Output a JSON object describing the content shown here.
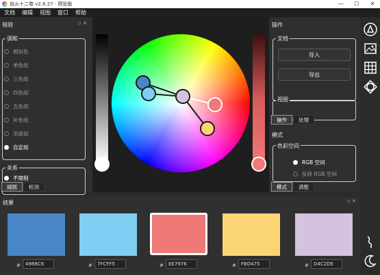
{
  "window": {
    "title": "焰火十二卷 v2.8.27 · 预览版",
    "minimize_glyph": "—",
    "maximize_glyph": "☐",
    "close_glyph": "✕"
  },
  "menu": [
    {
      "label": "文档"
    },
    {
      "label": "编辑"
    },
    {
      "label": "视图"
    },
    {
      "label": "窗口"
    },
    {
      "label": "帮助"
    }
  ],
  "rules_panel": {
    "title": "规则",
    "harmony_group": "调和",
    "harmony_options": [
      {
        "label": "相似色",
        "selected": false
      },
      {
        "label": "单色组",
        "selected": false
      },
      {
        "label": "三色组",
        "selected": false
      },
      {
        "label": "四色组",
        "selected": false
      },
      {
        "label": "五色组",
        "selected": false
      },
      {
        "label": "补色组",
        "selected": false
      },
      {
        "label": "浓度组",
        "selected": false
      },
      {
        "label": "自定组",
        "selected": true
      }
    ],
    "relation_group": "关系",
    "relation_value": "不限制",
    "tabs": [
      {
        "label": "规则",
        "active": true
      },
      {
        "label": "检测",
        "active": false
      }
    ]
  },
  "operations_panel": {
    "title": "操作",
    "document_group": "文档",
    "import_label": "导入",
    "export_label": "导出",
    "view_group": "视图",
    "tabs": [
      {
        "label": "操作",
        "active": true
      },
      {
        "label": "处理",
        "active": false
      }
    ]
  },
  "mode_panel": {
    "title": "模式",
    "color_space_group": "色彩空间",
    "options": [
      {
        "label": "RGB 空间",
        "selected": true
      },
      {
        "label": "反转 RGB 空间",
        "selected": false
      }
    ],
    "tabs": [
      {
        "label": "模式",
        "active": true
      },
      {
        "label": "调整",
        "active": false
      }
    ]
  },
  "result_panel": {
    "title": "结果",
    "hash": "#",
    "swatches": [
      {
        "hex": "4986C6",
        "color": "#4986C6",
        "selected": false
      },
      {
        "hex": "7FCFF5",
        "color": "#7FCFF5",
        "selected": false
      },
      {
        "hex": "EE7976",
        "color": "#EE7976",
        "selected": true
      },
      {
        "hex": "FBD475",
        "color": "#FBD475",
        "selected": false
      },
      {
        "hex": "D4C2DE",
        "color": "#D4C2DE",
        "selected": false
      }
    ]
  },
  "toolbar_icons": [
    "triangle-icon",
    "image-icon",
    "grid-icon",
    "swap-icon",
    "wave-icon",
    "moon-icon"
  ]
}
